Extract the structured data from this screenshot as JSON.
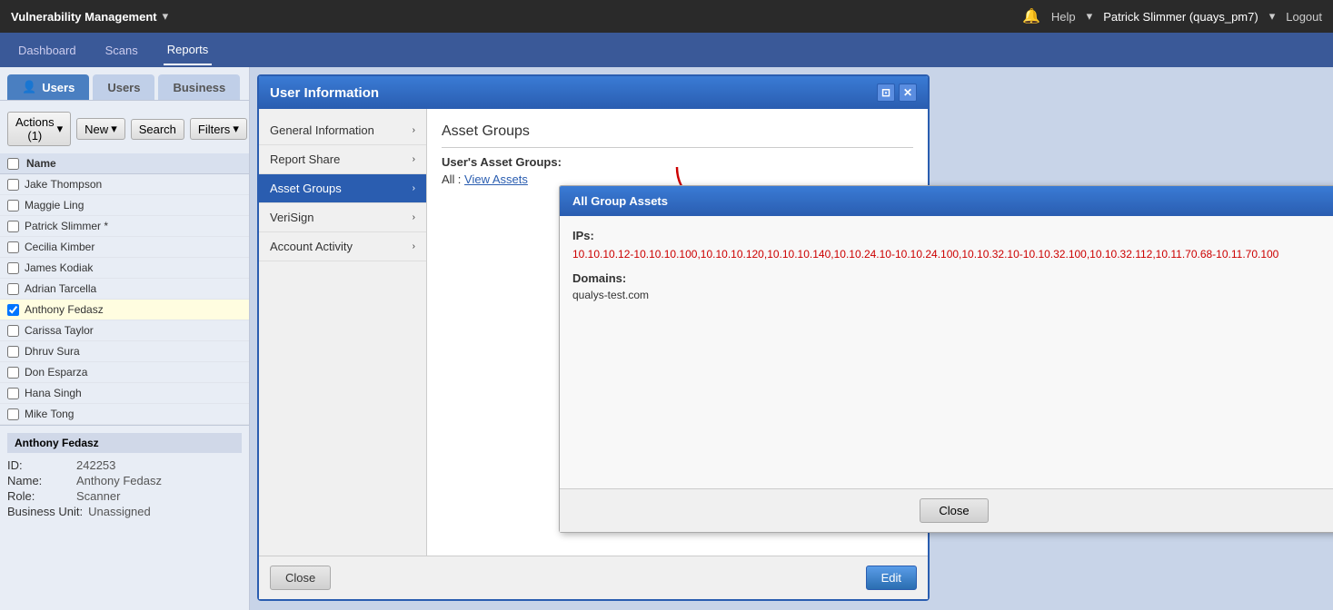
{
  "app": {
    "name": "Vulnerability Management",
    "dropdown_icon": "▾"
  },
  "top_nav": {
    "right_items": [
      "Help",
      "▾",
      "Patrick Slimmer (quays_pm7)",
      "▾",
      "Logout"
    ],
    "help_label": "Help",
    "user_label": "Patrick Slimmer (quays_pm7)",
    "logout_label": "Logout",
    "notification_icon": "🔔"
  },
  "second_nav": {
    "items": [
      "Dashboard",
      "Scans",
      "Reports"
    ]
  },
  "sidebar": {
    "tabs": [
      {
        "label": "Users",
        "icon": "👤",
        "active": true
      },
      {
        "label": "Users",
        "active": false
      },
      {
        "label": "Business",
        "active": false
      }
    ],
    "actions_label": "Actions (1)",
    "new_label": "New",
    "search_label": "Search",
    "filters_label": "Filters",
    "column_name": "Name",
    "users": [
      {
        "name": "Jake Thompson",
        "checked": false,
        "selected": false
      },
      {
        "name": "Maggie Ling",
        "checked": false,
        "selected": false
      },
      {
        "name": "Patrick Slimmer *",
        "checked": false,
        "selected": false
      },
      {
        "name": "Cecilia Kimber",
        "checked": false,
        "selected": false
      },
      {
        "name": "James Kodiak",
        "checked": false,
        "selected": false
      },
      {
        "name": "Adrian Tarcella",
        "checked": false,
        "selected": false
      },
      {
        "name": "Anthony Fedasz",
        "checked": true,
        "selected": true
      },
      {
        "name": "Carissa Taylor",
        "checked": false,
        "selected": false
      },
      {
        "name": "Dhruv Sura",
        "checked": false,
        "selected": false
      },
      {
        "name": "Don Esparza",
        "checked": false,
        "selected": false
      },
      {
        "name": "Hana Singh",
        "checked": false,
        "selected": false
      },
      {
        "name": "Mike Tong",
        "checked": false,
        "selected": false
      }
    ],
    "selected_user": "Anthony Fedasz",
    "details": {
      "id_label": "ID:",
      "id_value": "242253",
      "name_label": "Name:",
      "name_value": "Anthony Fedasz",
      "role_label": "Role:",
      "role_value": "Scanner",
      "business_unit_label": "Business Unit:",
      "business_unit_value": "Unassigned"
    }
  },
  "user_info_modal": {
    "title": "User Information",
    "nav_items": [
      {
        "label": "General Information",
        "active": false
      },
      {
        "label": "Report Share",
        "active": false
      },
      {
        "label": "Asset Groups",
        "active": true
      },
      {
        "label": "VeriSign",
        "active": false
      },
      {
        "label": "Account Activity",
        "active": false
      }
    ],
    "close_label": "Close",
    "edit_label": "Edit",
    "section_title": "Asset Groups",
    "users_asset_groups_label": "User's Asset Groups:",
    "all_label": "All",
    "view_assets_label": "View Assets"
  },
  "group_assets_modal": {
    "title": "All Group Assets",
    "ips_label": "IPs:",
    "ips_value": "10.10.10.12-10.10.10.100,10.10.10.120,10.10.10.140,10.10.24.10-10.10.24.100,10.10.32.10-10.10.32.100,10.10.32.112,10.11.70.68-10.11.70.100",
    "domains_label": "Domains:",
    "domains_value": "qualys-test.com",
    "close_label": "Close"
  }
}
